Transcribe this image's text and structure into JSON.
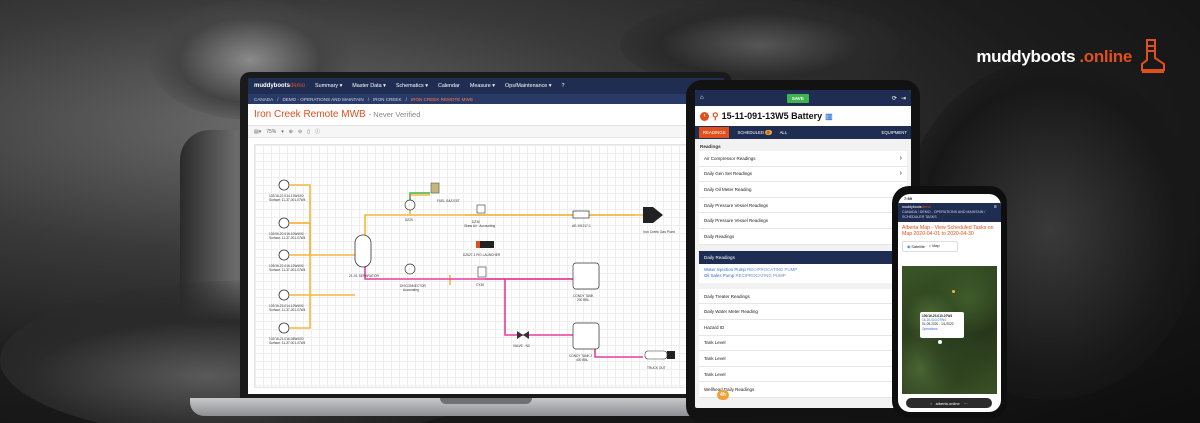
{
  "brand": {
    "name": "muddyboots",
    "suffix": ".online"
  },
  "laptop": {
    "logo": "muddyboots",
    "logo_suffix": "demo",
    "nav": [
      "Summary ▾",
      "Master Data ▾",
      "Schematics ▾",
      "Calendar",
      "Measure ▾",
      "Ops/Maintenance ▾"
    ],
    "breadcrumb": [
      "CANADA",
      "DEMO - OPERATIONS AND MAINTAIN",
      "IRON CREEK",
      "IRON CREEK REMOTE MWB"
    ],
    "title": "Iron Creek Remote MWB",
    "status": "- Never Verified",
    "zoom": "75%",
    "labels": {
      "well1": "102/16-22-014-13W4/00",
      "well1b": "Surface: 11-37-001-07W4",
      "well2": "102/06-20-016-10W4/00",
      "well2b": "Surface: 11-37-001-07W4",
      "well3": "103/16-22-016-12W4/00",
      "well3b": "Surface: 11-37-001-07W4",
      "well4": "102/16-23-014-12W4/00",
      "well4b": "Surface: 11-37-001-07W4",
      "well5": "102/16-21-016-08W4/00",
      "well5b": "Surface: 11-37-001-07W4",
      "sep": "21-01 SEPARATOR",
      "gas1": "DZ29",
      "fuel": "FUEL GAS EST",
      "meter1": "DZ30",
      "meter1b": "Glass Air - Accounting",
      "mix": "AE-101217-1",
      "pig": "DZ627-1 PIG LAUNCHER",
      "plant": "Iron Creek Gas Plant",
      "oil1": "DISCONNECTOR",
      "oil1b": "Accounting",
      "lact": "CY36",
      "tank1": "CONDY TANK",
      "tank1b": "200 BBL",
      "valve": "VALVE - NC",
      "tank2": "CONDY TANK 2",
      "tank2b": "400 BBL",
      "truck": "TRUCK OUT"
    }
  },
  "tablet": {
    "save": "SAVE",
    "title": "15-11-091-13W5 Battery",
    "tabs": {
      "readings": "READINGS",
      "scheduled": "SCHEDULED",
      "scheduled_count": "8",
      "all": "ALL",
      "equipment": "EQUIPMENT"
    },
    "section": "Readings",
    "list1": [
      "Air Compressor Readings",
      "Daily Gen Set Readings",
      "Daily Oil Meter Reading",
      "Daily Pressure Vessel Readings",
      "Daily Pressure Vessel Readings",
      "Daily Readings"
    ],
    "blue_header": "Daily Readings",
    "pumps": [
      {
        "name": "Water Injection Pump",
        "type": "RECIPROCATING PUMP"
      },
      {
        "name": "Oil Sales Pump",
        "type": "RECIPROCATING PUMP"
      }
    ],
    "list2": [
      "Daily Treater Readings",
      "Daily Water Meter Reading",
      "Hazard ID",
      "Tank Level",
      "Tank Level",
      "Tank Level",
      "Wellhead Daily Readings"
    ],
    "footer_badge": "4h"
  },
  "phone": {
    "time": "7:59",
    "logo": "muddyboots",
    "logo_suffix": "demo",
    "crumb": "CANADA / DEMO - OPERATIONS AND MAINTAIN / SCHEDULER TASKS",
    "title": "Alberta Map - View Scheduled Tasks on Map 2020-04-01 to 2020-04-30",
    "toggle": {
      "satellite": "Satellite",
      "map": "Map"
    },
    "popup": {
      "title": "100/16-20-010-07W4",
      "line1": "16-20-010-07W4",
      "line2": "01-09-2020 - 1/1/2020",
      "line3": "Operations"
    },
    "url": "alberta.online"
  },
  "colors": {
    "accent": "#e0501e",
    "navy": "#1f2d52",
    "gas": "#f5b53b",
    "oil": "#e83c9e",
    "green": "#3eb34f"
  }
}
